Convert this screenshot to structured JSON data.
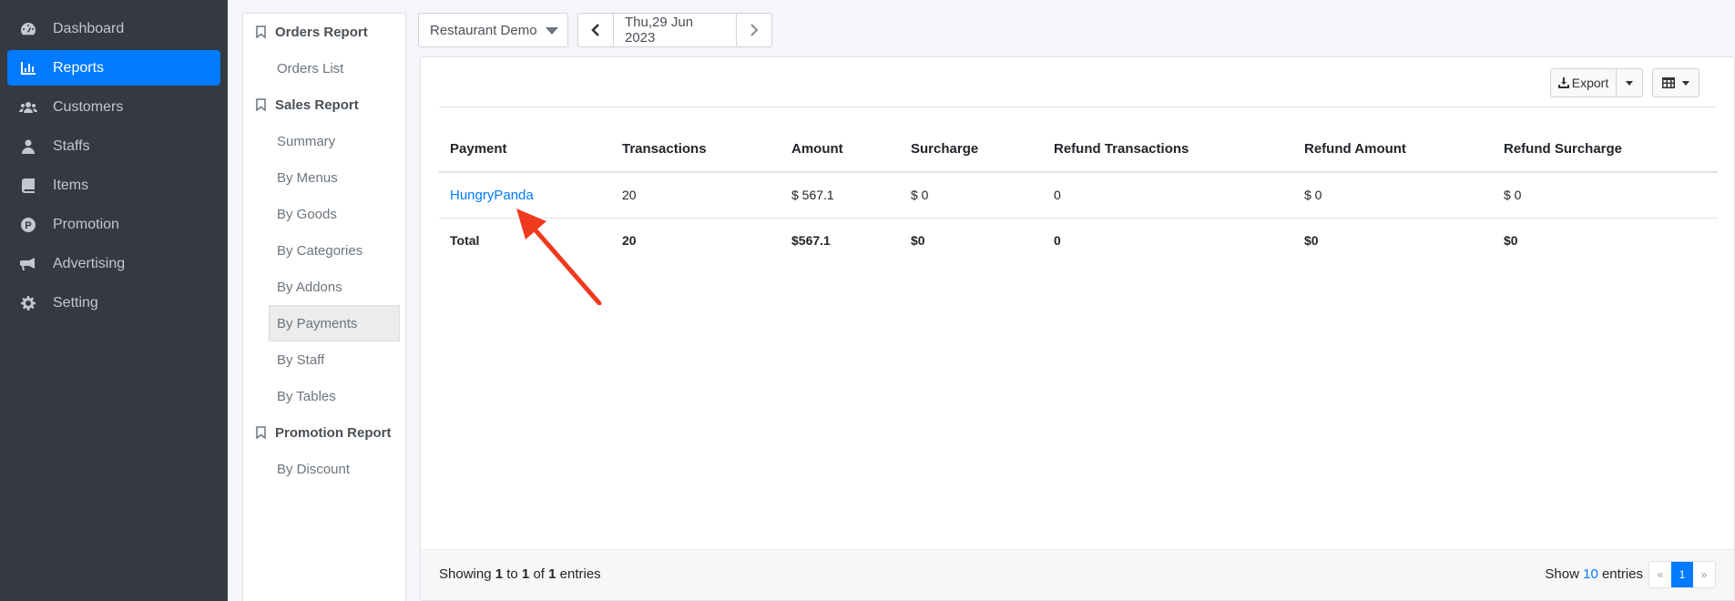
{
  "sidebar": {
    "items": [
      {
        "label": "Dashboard",
        "icon": "dashboard-icon"
      },
      {
        "label": "Reports",
        "icon": "bar-chart-icon",
        "active": true
      },
      {
        "label": "Customers",
        "icon": "users-icon"
      },
      {
        "label": "Staffs",
        "icon": "user-tie-icon"
      },
      {
        "label": "Items",
        "icon": "book-icon"
      },
      {
        "label": "Promotion",
        "icon": "product-p-icon"
      },
      {
        "label": "Advertising",
        "icon": "bullhorn-icon"
      },
      {
        "label": "Setting",
        "icon": "gear-icon"
      }
    ]
  },
  "submenu": {
    "orders_report": "Orders Report",
    "orders_list": "Orders List",
    "sales_report": "Sales Report",
    "summary": "Summary",
    "by_menus": "By Menus",
    "by_goods": "By Goods",
    "by_categories": "By Categories",
    "by_addons": "By Addons",
    "by_payments": "By Payments",
    "by_staff": "By Staff",
    "by_tables": "By Tables",
    "promotion_report": "Promotion Report",
    "by_discount": "By Discount"
  },
  "toolbar": {
    "store": "Restaurant Demo",
    "date": "Thu,29 Jun 2023",
    "export_label": "Export"
  },
  "table": {
    "headers": [
      "Payment",
      "Transactions",
      "Amount",
      "Surcharge",
      "Refund Transactions",
      "Refund Amount",
      "Refund Surcharge"
    ],
    "row": {
      "payment": "HungryPanda",
      "transactions": "20",
      "amount": "$ 567.1",
      "surcharge": "$ 0",
      "refund_transactions": "0",
      "refund_amount": "$ 0",
      "refund_surcharge": "$ 0"
    },
    "total": {
      "label": "Total",
      "transactions": "20",
      "amount": "$567.1",
      "surcharge": "$0",
      "refund_transactions": "0",
      "refund_amount": "$0",
      "refund_surcharge": "$0"
    }
  },
  "footer": {
    "showing_prefix": "Showing",
    "from": "1",
    "to_word": "to",
    "to": "1",
    "of_word": "of",
    "total": "1",
    "entries_word": "entries",
    "show_label": "Show",
    "page_size": "10",
    "show_suffix": "entries",
    "prev": "«",
    "page": "1",
    "next": "»"
  },
  "colors": {
    "sidebar_bg": "#343a40",
    "accent": "#007bff",
    "annotation_arrow": "#f03a1f"
  }
}
